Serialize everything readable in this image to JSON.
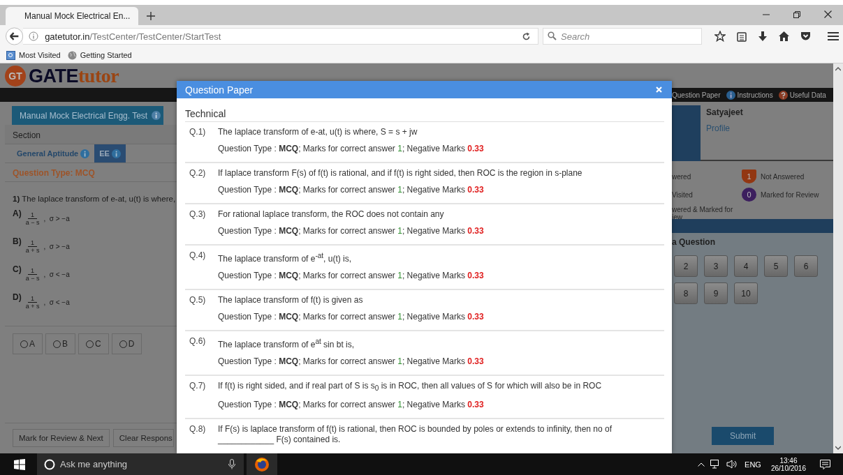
{
  "browser": {
    "tab_title": "Manual Mock Electrical En...",
    "url_host": "gatetutor.in",
    "url_path": "/TestCenter/TestCenter/StartTest",
    "search_placeholder": "Search",
    "bookmarks": [
      {
        "label": "Most Visited",
        "kind": "folder"
      },
      {
        "label": "Getting Started",
        "kind": "globe"
      }
    ]
  },
  "site": {
    "logo_mark": "GT",
    "logo_bold": "GATE",
    "logo_light": "tutor",
    "nav_links": [
      {
        "label": "Question Paper",
        "kind": "plain"
      },
      {
        "label": "Instructions",
        "kind": "info"
      },
      {
        "label": "Useful Data",
        "kind": "help"
      }
    ]
  },
  "test_name": "Manual Mock Electrical Engg. Test",
  "section_label": "Section",
  "sections": [
    {
      "label": "General Aptitude",
      "selected": false
    },
    {
      "label": "EE",
      "selected": true
    }
  ],
  "question_type": "Question Type: MCQ",
  "question": {
    "number": "1)",
    "text": "The laplace transform of e-at, u(t) is where,"
  },
  "options": [
    {
      "letter": "A)",
      "numerator": "1",
      "denominator": "a − s",
      "condition": ",  σ > −a"
    },
    {
      "letter": "B)",
      "numerator": "1",
      "denominator": "a + s",
      "condition": ",  σ > −a"
    },
    {
      "letter": "C)",
      "numerator": "1",
      "denominator": "a − s",
      "condition": ",  σ < −a"
    },
    {
      "letter": "D)",
      "numerator": "1",
      "denominator": "a + s",
      "condition": ",  σ < −a"
    }
  ],
  "answers": [
    {
      "label": "A",
      "selected": false
    },
    {
      "label": "B",
      "selected": false
    },
    {
      "label": "C",
      "selected": false
    },
    {
      "label": "D",
      "selected": false
    }
  ],
  "actions": [
    "Mark for Review & Next",
    "Clear Respons"
  ],
  "candidate": {
    "name": "Satyajeet",
    "link": "Profile"
  },
  "legend": [
    {
      "label": "wered",
      "kind": "partial"
    },
    {
      "label": "Not Answered",
      "kind": "not-answered",
      "count": "1"
    },
    {
      "label": "Visited",
      "kind": "partial"
    },
    {
      "label": "Marked for Review",
      "kind": "marked",
      "count": "0"
    },
    {
      "label": "wered & Marked for iew",
      "kind": "partial"
    }
  ],
  "palette_title": "a Question",
  "palette_rows": [
    [
      "2",
      "3",
      "4",
      "5",
      "6"
    ],
    [
      "8",
      "9",
      "10"
    ]
  ],
  "submit": "Submit",
  "modal": {
    "title": "Question Paper",
    "section": "Technical",
    "questions": [
      {
        "number": "Q.1)",
        "text": "The laplace transform of e-at, u(t) is where,  S = s + jw",
        "type_label": "Question Type : ",
        "type": "MCQ",
        "marks_label": "; Marks for correct answer ",
        "marks": "1",
        "negative_label": "; Negative Marks ",
        "negative": "0.33"
      },
      {
        "number": "Q.2)",
        "text": "If laplace transform F(s) of f(t) is rational, and if f(t) is right sided, then ROC is the region in s-plane",
        "type_label": "Question Type : ",
        "type": "MCQ",
        "marks_label": "; Marks for correct answer ",
        "marks": "1",
        "negative_label": "; Negative Marks ",
        "negative": "0.33"
      },
      {
        "number": "Q.3)",
        "text": "For rational laplace transform, the ROC does not contain any",
        "type_label": "Question Type : ",
        "type": "MCQ",
        "marks_label": "; Marks for correct answer ",
        "marks": "1",
        "negative_label": "; Negative Marks ",
        "negative": "0.33"
      },
      {
        "number": "Q.4)",
        "text": "The laplace transform of e$^{-at}$, u(t) is,",
        "type_label": "Question Type : ",
        "type": "MCQ",
        "marks_label": "; Marks for correct answer ",
        "marks": "1",
        "negative_label": "; Negative Marks ",
        "negative": "0.33"
      },
      {
        "number": "Q.5)",
        "text": "The laplace transform of f(t) is given as",
        "type_label": "Question Type : ",
        "type": "MCQ",
        "marks_label": "; Marks for correct answer ",
        "marks": "1",
        "negative_label": "; Negative Marks ",
        "negative": "0.33"
      },
      {
        "number": "Q.6)",
        "text": "The laplace transform of e$^{at}$ sin bt is,",
        "type_label": "Question Type : ",
        "type": "MCQ",
        "marks_label": "; Marks for correct answer ",
        "marks": "1",
        "negative_label": "; Negative Marks ",
        "negative": "0.33"
      },
      {
        "number": "Q.7)",
        "text": "If f(t) is right sided, and if real part of S is s$_{0}$ is in ROC, then all values of S for  which will also be in ROC",
        "type_label": "Question Type : ",
        "type": "MCQ",
        "marks_label": "; Marks for correct answer ",
        "marks": "1",
        "negative_label": "; Negative Marks ",
        "negative": "0.33"
      },
      {
        "number": "Q.8)",
        "text": "If F(s) is laplace transform of f(t) is rational, then ROC is bounded by poles or extends to infinity, then no of ____________ F(s) contained is."
      }
    ]
  },
  "taskbar": {
    "search_placeholder": "Ask me anything",
    "language": "ENG",
    "time": "13:46",
    "date": "26/10/2016"
  }
}
